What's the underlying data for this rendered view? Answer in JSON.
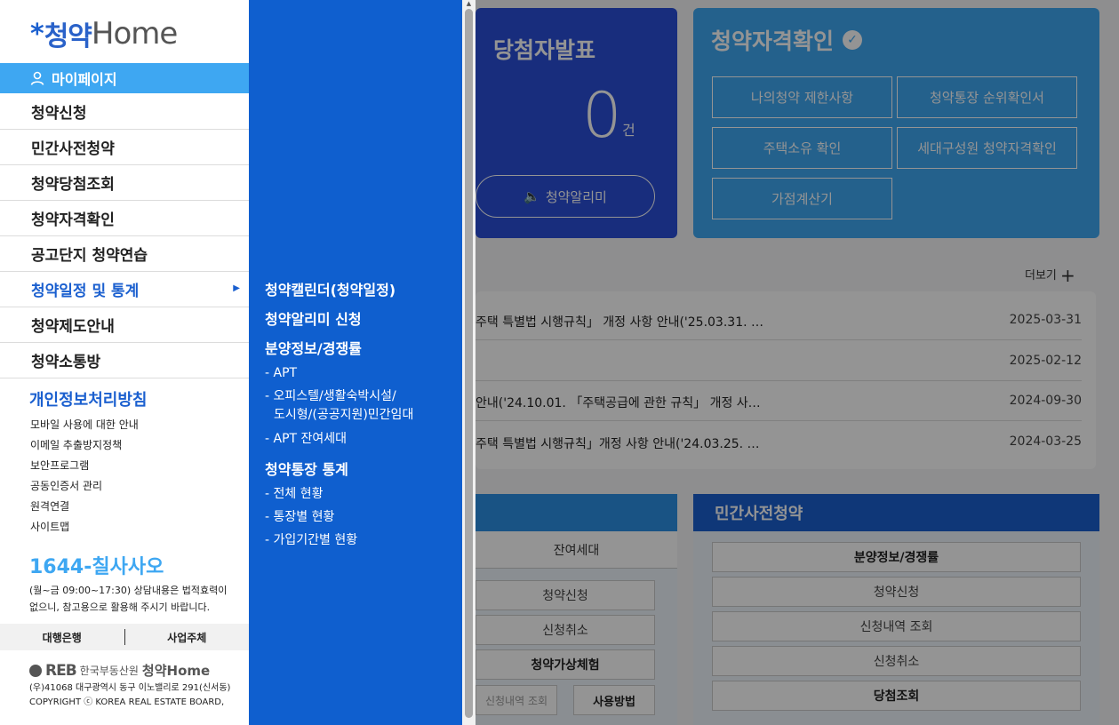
{
  "background": {
    "winners_card": {
      "title": "당첨자발표",
      "count": "0",
      "unit": "건",
      "alarm_label": "청약알리미"
    },
    "eligibility_card": {
      "title": "청약자격확인",
      "buttons": [
        "나의청약 제한사항",
        "청약통장 순위확인서",
        "주택소유 확인",
        "세대구성원 청약자격확인",
        "가점계산기"
      ]
    },
    "more_label": "더보기",
    "notices": [
      {
        "title": "주택 특별법 시행규칙」 개정 사항 안내('25.03.31. …",
        "date": "2025-03-31"
      },
      {
        "title": "",
        "date": "2025-02-12"
      },
      {
        "title": "안내('24.10.01. 「주택공급에 관한 규칙」 개정 사…",
        "date": "2024-09-30"
      },
      {
        "title": "주택 특별법 시행규칙」개정 사항 안내('24.03.25. …",
        "date": "2024-03-25"
      }
    ],
    "left_panel": {
      "subtitle": "잔여세대",
      "buttons": [
        "청약신청",
        "신청취소",
        "청약가상체험"
      ],
      "bottom_left": "신청내역 조회",
      "bottom_right": "사용방법"
    },
    "right_panel": {
      "title": "민간사전청약",
      "buttons": [
        "분양정보/경쟁률",
        "청약신청",
        "신청내역 조회",
        "신청취소",
        "당첨조회"
      ]
    }
  },
  "sidebar": {
    "logo": {
      "mark": "*",
      "ko": "청약",
      "en": "Home"
    },
    "mypage_label": "마이페이지",
    "menu": [
      "청약신청",
      "민간사전청약",
      "청약당첨조회",
      "청약자격확인",
      "공고단지 청약연습",
      "청약일정 및 통계",
      "청약제도안내",
      "청약소통방"
    ],
    "privacy_label": "개인정보처리방침",
    "links": [
      "모바일 사용에 대한 안내",
      "이메일 추출방지정책",
      "보안프로그램",
      "공동인증서 관리",
      "원격연결",
      "사이트맵"
    ],
    "phone": "1644-칠사사오",
    "phone_note": "(월~금 09:00~17:30) 상담내용은 법적효력이 없으니, 참고용으로 활용해 주시기 바랍니다.",
    "banks": [
      "대행은행",
      "사업주체"
    ],
    "footer": {
      "reb": "REB",
      "org": "한국부동산원",
      "brand": "청약Home"
    },
    "address": "(우)41068 대구광역시 동구 이노밸리로 291(신서동)",
    "copyright": "COPYRIGHT ⓒ KOREA REAL ESTATE BOARD,"
  },
  "flyout": {
    "items": [
      {
        "label": "청약캘린더(청약일정)",
        "kind": "heading"
      },
      {
        "label": "청약알리미 신청",
        "kind": "heading"
      },
      {
        "label": "분양정보/경쟁률",
        "kind": "heading"
      },
      {
        "label": "- APT",
        "kind": "sub"
      },
      {
        "label": "- 오피스텔/생활숙박시설/",
        "kind": "sub"
      },
      {
        "label": "도시형/(공공지원)민간임대",
        "kind": "sub"
      },
      {
        "label": "- APT 잔여세대",
        "kind": "sub"
      },
      {
        "label": "청약통장 통계",
        "kind": "heading"
      },
      {
        "label": "- 전체 현황",
        "kind": "sub"
      },
      {
        "label": "- 통장별 현황",
        "kind": "sub"
      },
      {
        "label": "- 가입기간별 현황",
        "kind": "sub"
      }
    ]
  },
  "colors": {
    "flyout": "#0f5fcf",
    "mypage": "#3ea7f2",
    "active_menu": "#1a5fcf"
  }
}
